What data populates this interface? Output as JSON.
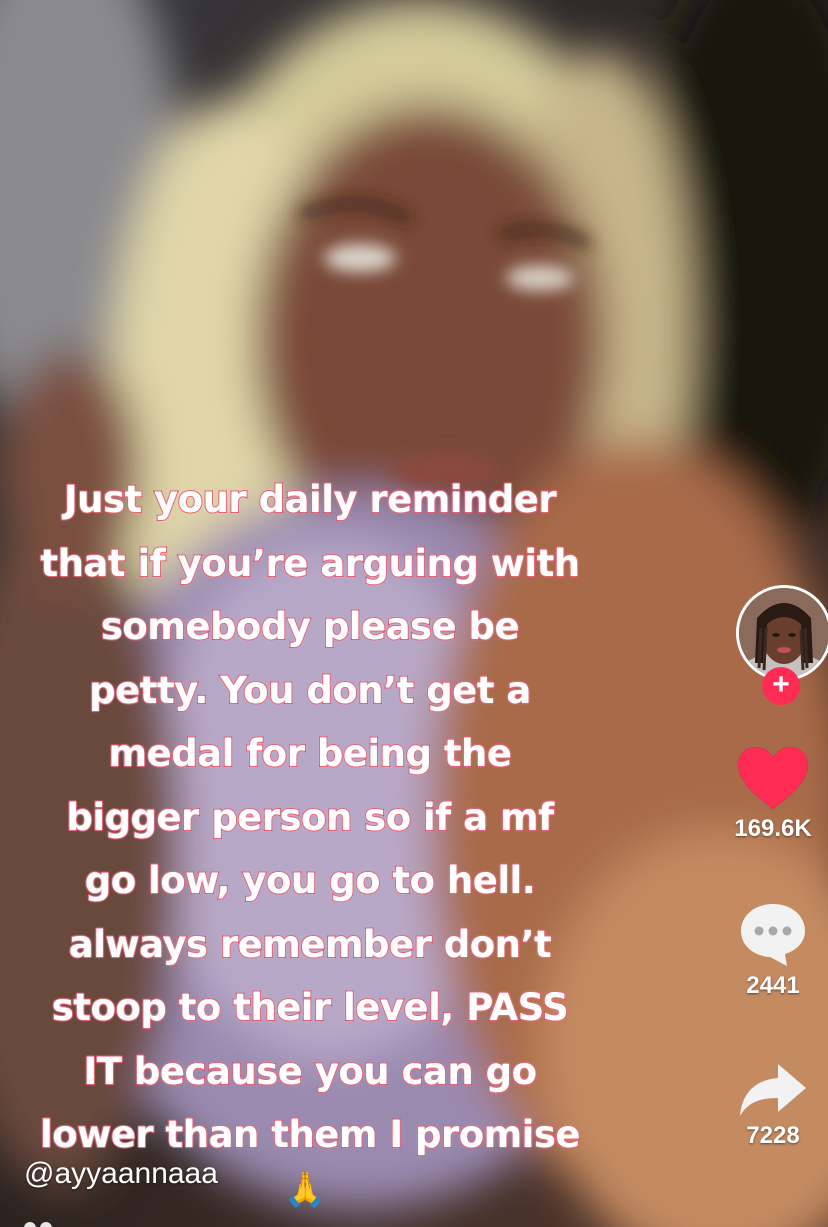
{
  "caption": {
    "lines": [
      "Just your daily reminder",
      "that if you’re arguing with",
      "somebody please be",
      "petty. You don’t get a",
      "medal for being the",
      "bigger person so if a mf",
      "go low, you go to hell.",
      "always remember don’t",
      "stoop to their level, PASS",
      "IT because you can go",
      "lower than them I promise"
    ],
    "stroke_color": "#e0425a"
  },
  "author": {
    "username": "@ayyaannaaa"
  },
  "emoji": "🙏",
  "actions": {
    "follow_label": "+",
    "likes": "169.6K",
    "comments": "2441",
    "shares": "7228"
  },
  "colors": {
    "like": "#fe2c55",
    "follow": "#fe2c55"
  },
  "icons": {
    "like": "heart-icon",
    "comment": "comment-bubble-icon",
    "share": "share-arrow-icon",
    "follow": "plus-icon"
  }
}
